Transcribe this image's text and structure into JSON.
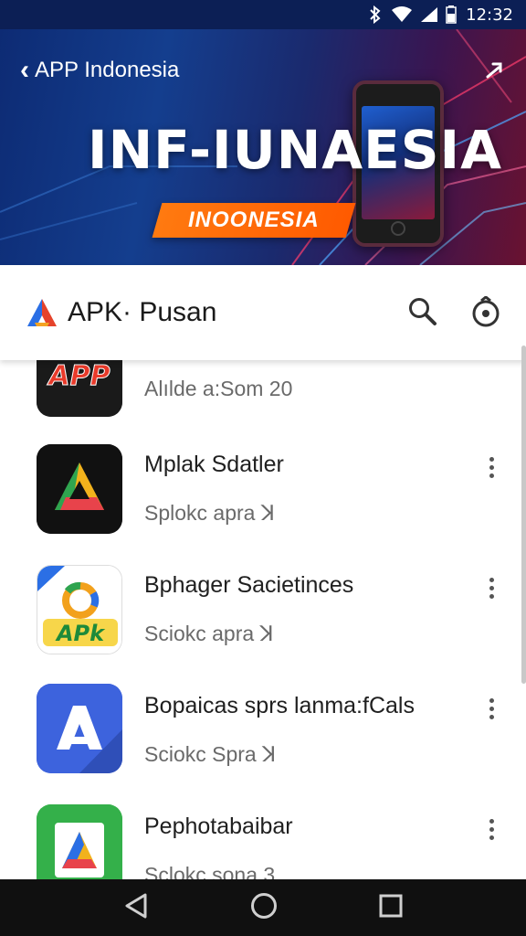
{
  "status_bar": {
    "time": "12:32",
    "icons": [
      "bluetooth-icon",
      "wifi-icon",
      "signal-icon",
      "battery-icon"
    ]
  },
  "banner": {
    "back_label": "APP Indonesia",
    "title": "INF-IUNAESIA",
    "ribbon": "INOONESIA",
    "colors": {
      "ribbon": "#ff6a00",
      "background": "#143e8e"
    }
  },
  "header": {
    "app_name": "APK· Pusan",
    "icons": [
      "apk-logo-icon",
      "search-icon",
      "settings-icon"
    ]
  },
  "apps": [
    {
      "name": "",
      "sub": "Alılde a:Som 20",
      "icon": "app-red-icon"
    },
    {
      "name": "Mplak Sdatler",
      "sub": "Splokc apra  ꓘ",
      "icon": "triangle-icon"
    },
    {
      "name": "Bphager Sacietinces",
      "sub": "Sciokc apra  ꓘ",
      "icon": "apk-gear-icon"
    },
    {
      "name": "Bopaicas sprs lanma:fCals",
      "sub": "Sciokc Spra  ꓘ",
      "icon": "a-arrow-icon"
    },
    {
      "name": "Pephotabaibar",
      "sub": "Sclokc sona  3",
      "icon": "drive-icon"
    }
  ],
  "nav": {
    "icons": [
      "back-icon",
      "home-icon",
      "recents-icon"
    ]
  }
}
